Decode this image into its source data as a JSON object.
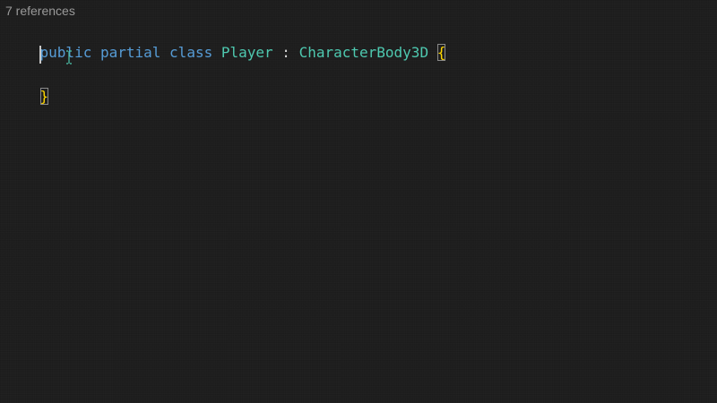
{
  "editor": {
    "codelens": "7 references",
    "line1": {
      "kw_public": "public",
      "kw_partial": "partial",
      "kw_class": "class",
      "class_name": "Player",
      "colon": ":",
      "base_type": "CharacterBody3D",
      "open_brace": "{"
    },
    "line3": {
      "close_brace": "}"
    },
    "colors": {
      "background": "#1e1e1e",
      "keyword": "#569cd6",
      "type": "#4ec9b0",
      "brace": "#ffd700",
      "codelens": "#999999",
      "cursor_icon": "#4ec9b0"
    },
    "icons": {
      "mouse_cursor": "ibeam-cursor-icon"
    }
  }
}
